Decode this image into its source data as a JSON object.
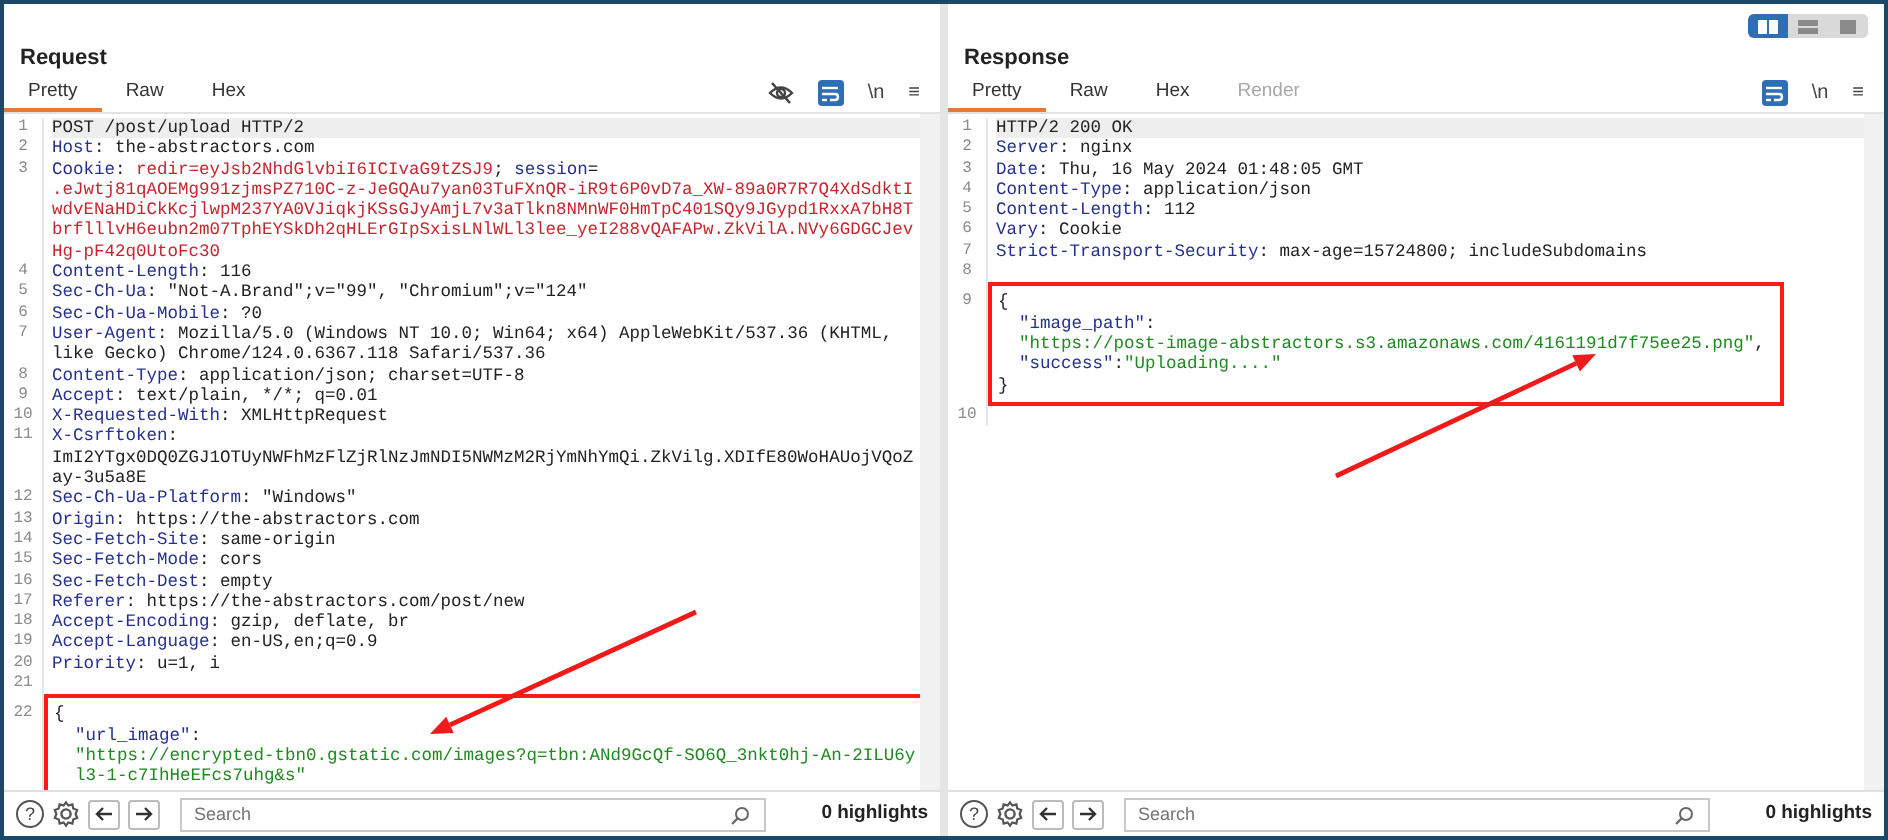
{
  "request": {
    "title": "Request",
    "tabs": [
      {
        "label": "Pretty",
        "selected": true,
        "disabled": false
      },
      {
        "label": "Raw",
        "selected": false,
        "disabled": false
      },
      {
        "label": "Hex",
        "selected": false,
        "disabled": false
      }
    ],
    "toolbar": [
      {
        "kind": "hide"
      },
      {
        "kind": "wrap",
        "on": true
      },
      {
        "kind": "newline",
        "label": "\\n"
      },
      {
        "kind": "menu",
        "label": "≡"
      }
    ],
    "lines": [
      {
        "number": "1",
        "current": true,
        "rows": [
          {
            "parts": [
              {
                "kind": "plain",
                "text": "POST /post/upload HTTP/2"
              }
            ]
          }
        ]
      },
      {
        "number": "2",
        "current": false,
        "rows": [
          {
            "parts": [
              {
                "kind": "name",
                "text": "Host"
              },
              {
                "kind": "plain",
                "text": ": the-abstractors.com"
              }
            ]
          }
        ]
      },
      {
        "number": "3",
        "current": false,
        "rows": [
          {
            "parts": [
              {
                "kind": "name",
                "text": "Cookie"
              },
              {
                "kind": "plain",
                "text": ": "
              },
              {
                "kind": "cookie",
                "text": "redir=eyJsb2NhdGlvbiI6ICIvaG9tZSJ9"
              },
              {
                "kind": "plain",
                "text": "; "
              },
              {
                "kind": "name",
                "text": "session"
              },
              {
                "kind": "plain",
                "text": "="
              }
            ]
          },
          {
            "parts": [
              {
                "kind": "cookie",
                "text": ".eJwtj81qAOEMg991zjmsPZ710C-z-JeGQAu7yan03TuFXnQR-iR9t6P0vD7a_XW-89a0R7R7Q4XdSdktI"
              }
            ]
          },
          {
            "parts": [
              {
                "kind": "cookie",
                "text": "wdvENaHDiCkKcjlwpM237YA0VJiqkjKSsGJyAmjL7v3aTlkn8NMnWF0HmTpC401SQy9JGypd1RxxA7bH8T"
              }
            ]
          },
          {
            "parts": [
              {
                "kind": "cookie",
                "text": "brflllvH6eubn2m07TphEYSkDh2qHLErGIpSxisLNlWLl3lee_yeI288vQAFAPw.ZkVilA.NVy6GDGCJev"
              }
            ]
          },
          {
            "parts": [
              {
                "kind": "cookie",
                "text": "Hg-pF42q0UtoFc30"
              }
            ]
          }
        ]
      },
      {
        "number": "4",
        "current": false,
        "rows": [
          {
            "parts": [
              {
                "kind": "name",
                "text": "Content-Length"
              },
              {
                "kind": "plain",
                "text": ": 116"
              }
            ]
          }
        ]
      },
      {
        "number": "5",
        "current": false,
        "rows": [
          {
            "parts": [
              {
                "kind": "name",
                "text": "Sec-Ch-Ua"
              },
              {
                "kind": "plain",
                "text": ": \"Not-A.Brand\";v=\"99\", \"Chromium\";v=\"124\""
              }
            ]
          }
        ]
      },
      {
        "number": "6",
        "current": false,
        "rows": [
          {
            "parts": [
              {
                "kind": "name",
                "text": "Sec-Ch-Ua-Mobile"
              },
              {
                "kind": "plain",
                "text": ": ?0"
              }
            ]
          }
        ]
      },
      {
        "number": "7",
        "current": false,
        "rows": [
          {
            "parts": [
              {
                "kind": "name",
                "text": "User-Agent"
              },
              {
                "kind": "plain",
                "text": ": Mozilla/5.0 (Windows NT 10.0; Win64; x64) AppleWebKit/537.36 (KHTML,"
              }
            ]
          },
          {
            "parts": [
              {
                "kind": "plain",
                "text": "like Gecko) Chrome/124.0.6367.118 Safari/537.36"
              }
            ]
          }
        ]
      },
      {
        "number": "8",
        "current": false,
        "rows": [
          {
            "parts": [
              {
                "kind": "name",
                "text": "Content-Type"
              },
              {
                "kind": "plain",
                "text": ": application/json; charset=UTF-8"
              }
            ]
          }
        ]
      },
      {
        "number": "9",
        "current": false,
        "rows": [
          {
            "parts": [
              {
                "kind": "name",
                "text": "Accept"
              },
              {
                "kind": "plain",
                "text": ": text/plain, */*; q=0.01"
              }
            ]
          }
        ]
      },
      {
        "number": "10",
        "current": false,
        "rows": [
          {
            "parts": [
              {
                "kind": "name",
                "text": "X-Requested-With"
              },
              {
                "kind": "plain",
                "text": ": XMLHttpRequest"
              }
            ]
          }
        ]
      },
      {
        "number": "11",
        "current": false,
        "rows": [
          {
            "parts": [
              {
                "kind": "name",
                "text": "X-Csrftoken"
              },
              {
                "kind": "plain",
                "text": ":"
              }
            ]
          },
          {
            "parts": [
              {
                "kind": "plain",
                "text": "ImI2YTgx0DQ0ZGJ1OTUyNWFhMzFlZjRlNzJmNDI5NWMzM2RjYmNhYmQi.ZkVilg.XDIfE80WoHAUojVQoZ"
              }
            ]
          },
          {
            "parts": [
              {
                "kind": "plain",
                "text": "ay-3u5a8E"
              }
            ]
          }
        ]
      },
      {
        "number": "12",
        "current": false,
        "rows": [
          {
            "parts": [
              {
                "kind": "name",
                "text": "Sec-Ch-Ua-Platform"
              },
              {
                "kind": "plain",
                "text": ": \"Windows\""
              }
            ]
          }
        ]
      },
      {
        "number": "13",
        "current": false,
        "rows": [
          {
            "parts": [
              {
                "kind": "name",
                "text": "Origin"
              },
              {
                "kind": "plain",
                "text": ": https://the-abstractors.com"
              }
            ]
          }
        ]
      },
      {
        "number": "14",
        "current": false,
        "rows": [
          {
            "parts": [
              {
                "kind": "name",
                "text": "Sec-Fetch-Site"
              },
              {
                "kind": "plain",
                "text": ": same-origin"
              }
            ]
          }
        ]
      },
      {
        "number": "15",
        "current": false,
        "rows": [
          {
            "parts": [
              {
                "kind": "name",
                "text": "Sec-Fetch-Mode"
              },
              {
                "kind": "plain",
                "text": ": cors"
              }
            ]
          }
        ]
      },
      {
        "number": "16",
        "current": false,
        "rows": [
          {
            "parts": [
              {
                "kind": "name",
                "text": "Sec-Fetch-Dest"
              },
              {
                "kind": "plain",
                "text": ": empty"
              }
            ]
          }
        ]
      },
      {
        "number": "17",
        "current": false,
        "rows": [
          {
            "parts": [
              {
                "kind": "name",
                "text": "Referer"
              },
              {
                "kind": "plain",
                "text": ": https://the-abstractors.com/post/new"
              }
            ]
          }
        ]
      },
      {
        "number": "18",
        "current": false,
        "rows": [
          {
            "parts": [
              {
                "kind": "name",
                "text": "Accept-Encoding"
              },
              {
                "kind": "plain",
                "text": ": gzip, deflate, br"
              }
            ]
          }
        ]
      },
      {
        "number": "19",
        "current": false,
        "rows": [
          {
            "parts": [
              {
                "kind": "name",
                "text": "Accept-Language"
              },
              {
                "kind": "plain",
                "text": ": en-US,en;q=0.9"
              }
            ]
          }
        ]
      },
      {
        "number": "20",
        "current": false,
        "rows": [
          {
            "parts": [
              {
                "kind": "name",
                "text": "Priority"
              },
              {
                "kind": "plain",
                "text": ": u=1, i"
              }
            ]
          }
        ]
      },
      {
        "number": "21",
        "current": false
      }
    ],
    "highlighted_lines": [
      {
        "number": "22",
        "current": false,
        "rows": [
          {
            "parts": [
              {
                "kind": "plain",
                "text": "{"
              }
            ]
          },
          {
            "indent": true,
            "parts": [
              {
                "kind": "key",
                "text": "\"url_image\""
              },
              {
                "kind": "plain",
                "text": ":"
              }
            ]
          },
          {
            "indent": true,
            "parts": [
              {
                "kind": "string",
                "text": "\"https://encrypted-tbn0.gstatic.com/images?q=tbn:ANd9GcQf-SO6Q_3nkt0hj-An-2ILU6y"
              }
            ]
          },
          {
            "indent": true,
            "parts": [
              {
                "kind": "string",
                "text": "l3-1-c7IhHeEFcs7uhg&s\""
              }
            ]
          }
        ]
      }
    ],
    "pointer_arrow": true,
    "footer": {
      "help": "?",
      "search": {
        "placeholder": "Search"
      },
      "highlights": "0 highlights"
    }
  },
  "response": {
    "title": "Response",
    "layout_buttons": [
      {
        "kind": "columns",
        "selected": true
      },
      {
        "kind": "rows",
        "selected": false
      },
      {
        "kind": "single",
        "selected": false
      }
    ],
    "tabs": [
      {
        "label": "Pretty",
        "selected": true,
        "disabled": false
      },
      {
        "label": "Raw",
        "selected": false,
        "disabled": false
      },
      {
        "label": "Hex",
        "selected": false,
        "disabled": false
      },
      {
        "label": "Render",
        "selected": false,
        "disabled": true
      }
    ],
    "toolbar": [
      {
        "kind": "wrap",
        "on": true
      },
      {
        "kind": "newline",
        "label": "\\n"
      },
      {
        "kind": "menu",
        "label": "≡"
      }
    ],
    "lines": [
      {
        "number": "1",
        "current": true,
        "rows": [
          {
            "parts": [
              {
                "kind": "plain",
                "text": "HTTP/2 200 OK"
              }
            ]
          }
        ]
      },
      {
        "number": "2",
        "current": false,
        "rows": [
          {
            "parts": [
              {
                "kind": "name",
                "text": "Server"
              },
              {
                "kind": "plain",
                "text": ": nginx"
              }
            ]
          }
        ]
      },
      {
        "number": "3",
        "current": false,
        "rows": [
          {
            "parts": [
              {
                "kind": "name",
                "text": "Date"
              },
              {
                "kind": "plain",
                "text": ": Thu, 16 May 2024 01:48:05 GMT"
              }
            ]
          }
        ]
      },
      {
        "number": "4",
        "current": false,
        "rows": [
          {
            "parts": [
              {
                "kind": "name",
                "text": "Content-Type"
              },
              {
                "kind": "plain",
                "text": ": application/json"
              }
            ]
          }
        ]
      },
      {
        "number": "5",
        "current": false,
        "rows": [
          {
            "parts": [
              {
                "kind": "name",
                "text": "Content-Length"
              },
              {
                "kind": "plain",
                "text": ": 112"
              }
            ]
          }
        ]
      },
      {
        "number": "6",
        "current": false,
        "rows": [
          {
            "parts": [
              {
                "kind": "name",
                "text": "Vary"
              },
              {
                "kind": "plain",
                "text": ": Cookie"
              }
            ]
          }
        ]
      },
      {
        "number": "7",
        "current": false,
        "rows": [
          {
            "parts": [
              {
                "kind": "name",
                "text": "Strict-Transport-Security"
              },
              {
                "kind": "plain",
                "text": ": max-age=15724800; includeSubdomains"
              }
            ]
          }
        ]
      },
      {
        "number": "8",
        "current": false
      }
    ],
    "highlighted_lines": [
      {
        "number": "9",
        "current": false,
        "rows": [
          {
            "parts": [
              {
                "kind": "plain",
                "text": "{"
              }
            ]
          },
          {
            "indent": true,
            "parts": [
              {
                "kind": "key",
                "text": "\"image_path\""
              },
              {
                "kind": "plain",
                "text": ":"
              }
            ]
          },
          {
            "indent": true,
            "parts": [
              {
                "kind": "string",
                "text": "\"https://post-image-abstractors.s3.amazonaws.com/4161191d7f75ee25.png\""
              },
              {
                "kind": "plain",
                "text": ","
              }
            ]
          },
          {
            "indent": true,
            "parts": [
              {
                "kind": "key",
                "text": "\"success\""
              },
              {
                "kind": "plain",
                "text": ":"
              },
              {
                "kind": "string",
                "text": "\"Uploading....\""
              }
            ]
          },
          {
            "parts": [
              {
                "kind": "plain",
                "text": "}"
              }
            ]
          }
        ]
      }
    ],
    "after_lines": [
      {
        "number": "10",
        "current": false
      }
    ],
    "pointer_arrow": true,
    "footer": {
      "help": "?",
      "search": {
        "placeholder": "Search"
      },
      "highlights": "0 highlights"
    }
  }
}
